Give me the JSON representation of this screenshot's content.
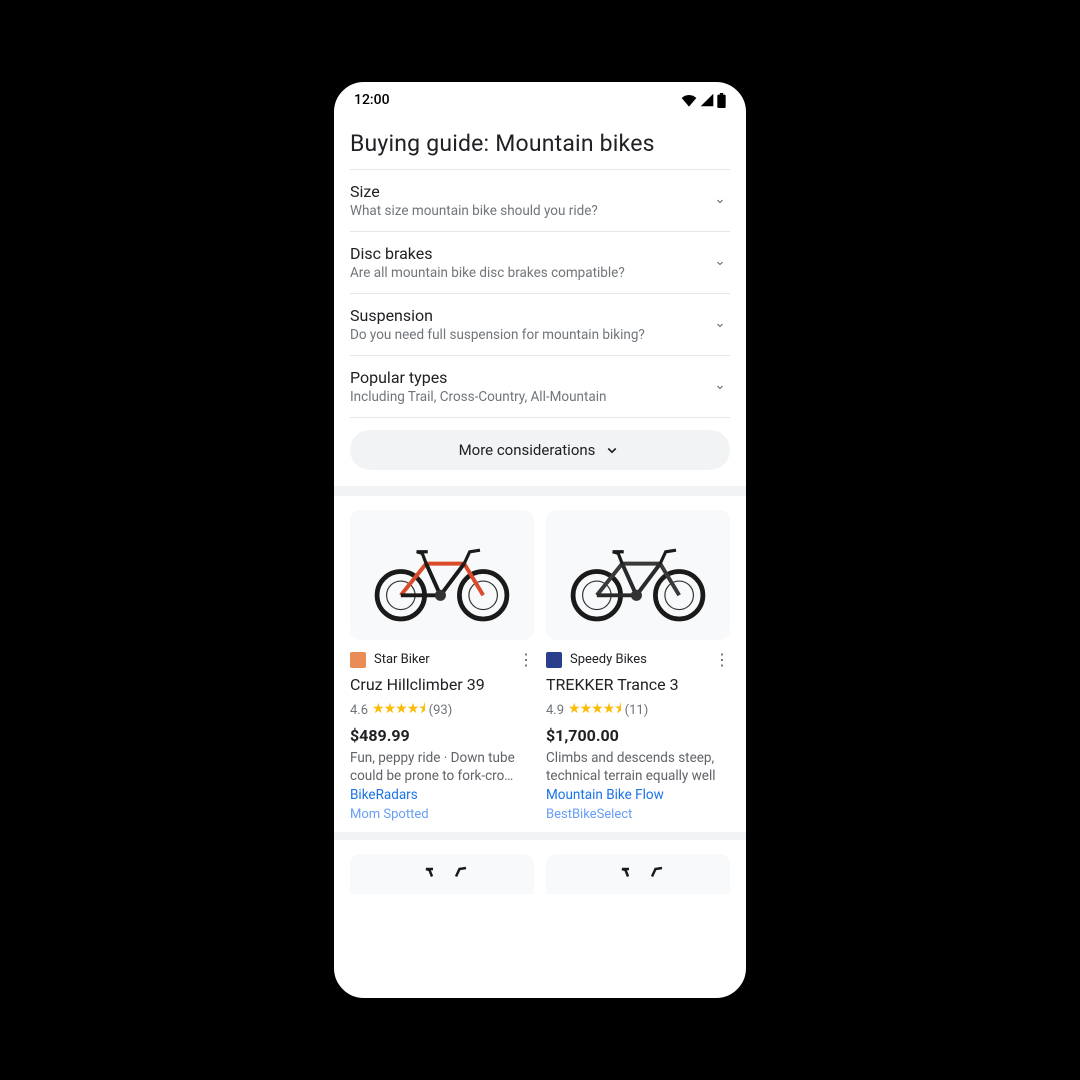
{
  "status": {
    "time": "12:00"
  },
  "header": {
    "title": "Buying guide: Mountain bikes"
  },
  "accordion": [
    {
      "title": "Size",
      "sub": "What size mountain bike should you ride?"
    },
    {
      "title": "Disc brakes",
      "sub": "Are all mountain bike disc brakes compatible?"
    },
    {
      "title": "Suspension",
      "sub": "Do you need full suspension for mountain biking?"
    },
    {
      "title": "Popular types",
      "sub": "Including Trail, Cross-Country, All-Mountain"
    }
  ],
  "more_button": "More considerations",
  "products": [
    {
      "seller": "Star Biker",
      "seller_color": "#ea8c55",
      "name": "Cruz Hillclimber 39",
      "rating": "4.6",
      "reviews": "(93)",
      "price": "$489.99",
      "blurb": "Fun, peppy ride · Down tube could be prone to fork-cro…",
      "source": "BikeRadars",
      "source2": "Mom Spotted"
    },
    {
      "seller": "Speedy Bikes",
      "seller_color": "#2a3e8c",
      "name": "TREKKER Trance 3",
      "rating": "4.9",
      "reviews": "(11)",
      "price": "$1,700.00",
      "blurb": "Climbs and descends steep, technical terrain equally well",
      "source": "Mountain Bike Flow",
      "source2": "BestBikeSelect"
    }
  ]
}
